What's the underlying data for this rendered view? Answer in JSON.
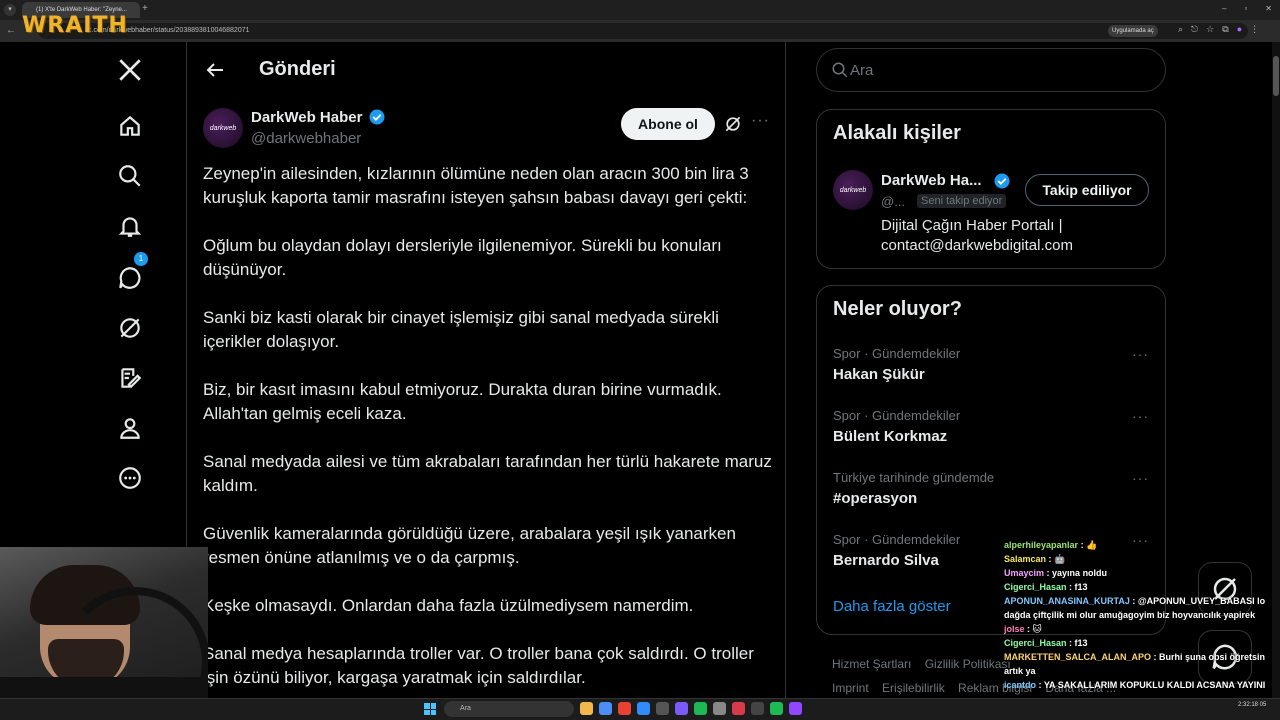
{
  "browser": {
    "tab_title": "(1) X'te DarkWeb Haber: \"Zeyne...",
    "url": "x.com/darkwebhaber/status/2038893810046882071",
    "open_app_label": "Uygulamada aç",
    "overlay_logo": "WRAITH"
  },
  "nav": {
    "notifications_badge": "1",
    "items": [
      "x-logo-icon",
      "home-icon",
      "search-icon",
      "bell-icon",
      "message-icon",
      "grok-icon",
      "edit-icon",
      "profile-icon",
      "more-icon"
    ]
  },
  "header": {
    "title": "Gönderi"
  },
  "tweet": {
    "author_name": "DarkWeb Haber",
    "author_handle": "@darkwebhaber",
    "avatar_text": "darkweb",
    "follow_label": "Abone ol",
    "paragraphs": [
      "Zeynep'in ailesinden, kızlarının ölümüne neden olan aracın 300 bin lira 3 kuruşluk kaporta tamir masrafını isteyen şahsın babası davayı geri çekti:",
      "Oğlum bu olaydan dolayı dersleriyle ilgilenemiyor. Sürekli bu konuları düşünüyor.",
      "Sanki biz kasti olarak bir cinayet işlemişiz gibi sanal medyada sürekli içerikler dolaşıyor.",
      "Biz, bir kasıt imasını kabul etmiyoruz. Durakta duran birine vurmadık. Allah'tan gelmiş eceli kaza.",
      "Sanal medyada ailesi ve tüm akrabaları tarafından her türlü hakarete maruz kaldım.",
      "Güvenlik kameralarında görüldüğü üzere, arabalara yeşil ışık yanarken resmen önüne atlanılmış ve o da çarpmış.",
      "Keşke olmasaydı. Onlardan daha fazla üzülmediysem namerdim.",
      "Sanal medya hesaplarında troller var. O troller bana çok saldırdı. O troller işin özünü biliyor, kargaşa yaratmak için saldırdılar."
    ]
  },
  "search": {
    "placeholder": "Ara"
  },
  "related": {
    "title": "Alakalı kişiler",
    "name": "DarkWeb Ha...",
    "handle": "@...",
    "follows_you": "Seni takip ediyor",
    "button": "Takip ediliyor",
    "bio": "Dijital Çağın Haber Portalı | contact@darkwebdigital.com"
  },
  "trends": {
    "title": "Neler oluyor?",
    "items": [
      {
        "meta": "Spor · Gündemdekiler",
        "name": "Hakan Şükür"
      },
      {
        "meta": "Spor · Gündemdekiler",
        "name": "Bülent Korkmaz"
      },
      {
        "meta": "Türkiye tarihinde gündemde",
        "name": "#operasyon"
      },
      {
        "meta": "Spor · Gündemdekiler",
        "name": "Bernardo Silva"
      }
    ],
    "show_more": "Daha fazla göster"
  },
  "footer": {
    "links": [
      "Hizmet Şartları",
      "Gizlilik Politikası",
      "Imprint",
      "Erişilebilirlik",
      "Reklam bilgisi",
      "Daha fazla ..."
    ]
  },
  "chat": [
    {
      "user": "alperhileyapanlar",
      "msg": ": 👍",
      "color": "#9ae66e"
    },
    {
      "user": "Salamcan",
      "msg": ": 🤖",
      "color": "#f5e663"
    },
    {
      "user": "Umaycim",
      "msg": ": yayına noldu",
      "color": "#f5a3ff"
    },
    {
      "user": "Cigerci_Hasan",
      "msg": ": f13",
      "color": "#8dffa1"
    },
    {
      "user": "APONUN_ANASINA_KURTAJ",
      "msg": ": @APONUN_UVEY_BABASI lo dağda çiftçilik mi olur amuğagoyim biz hoyvancılık yapirek",
      "color": "#7ec8ff"
    },
    {
      "user": "jolse",
      "msg": ": 🐱",
      "color": "#ff7eb3"
    },
    {
      "user": "Cigerci_Hasan",
      "msg": ": f13",
      "color": "#8dffa1"
    },
    {
      "user": "MARKETTEN_SALCA_ALAN_APO",
      "msg": ": Burhi şuna obsi öğretsin artık ya",
      "color": "#ffd36e"
    },
    {
      "user": "icantdo",
      "msg": ": YA SAKALLARIM KOPUKLU KALDI ACSANA YAYINI",
      "color": "#7ec8ff"
    }
  ],
  "taskbar": {
    "search_placeholder": "Ara",
    "time": "2:32:18 05",
    "date": ""
  }
}
